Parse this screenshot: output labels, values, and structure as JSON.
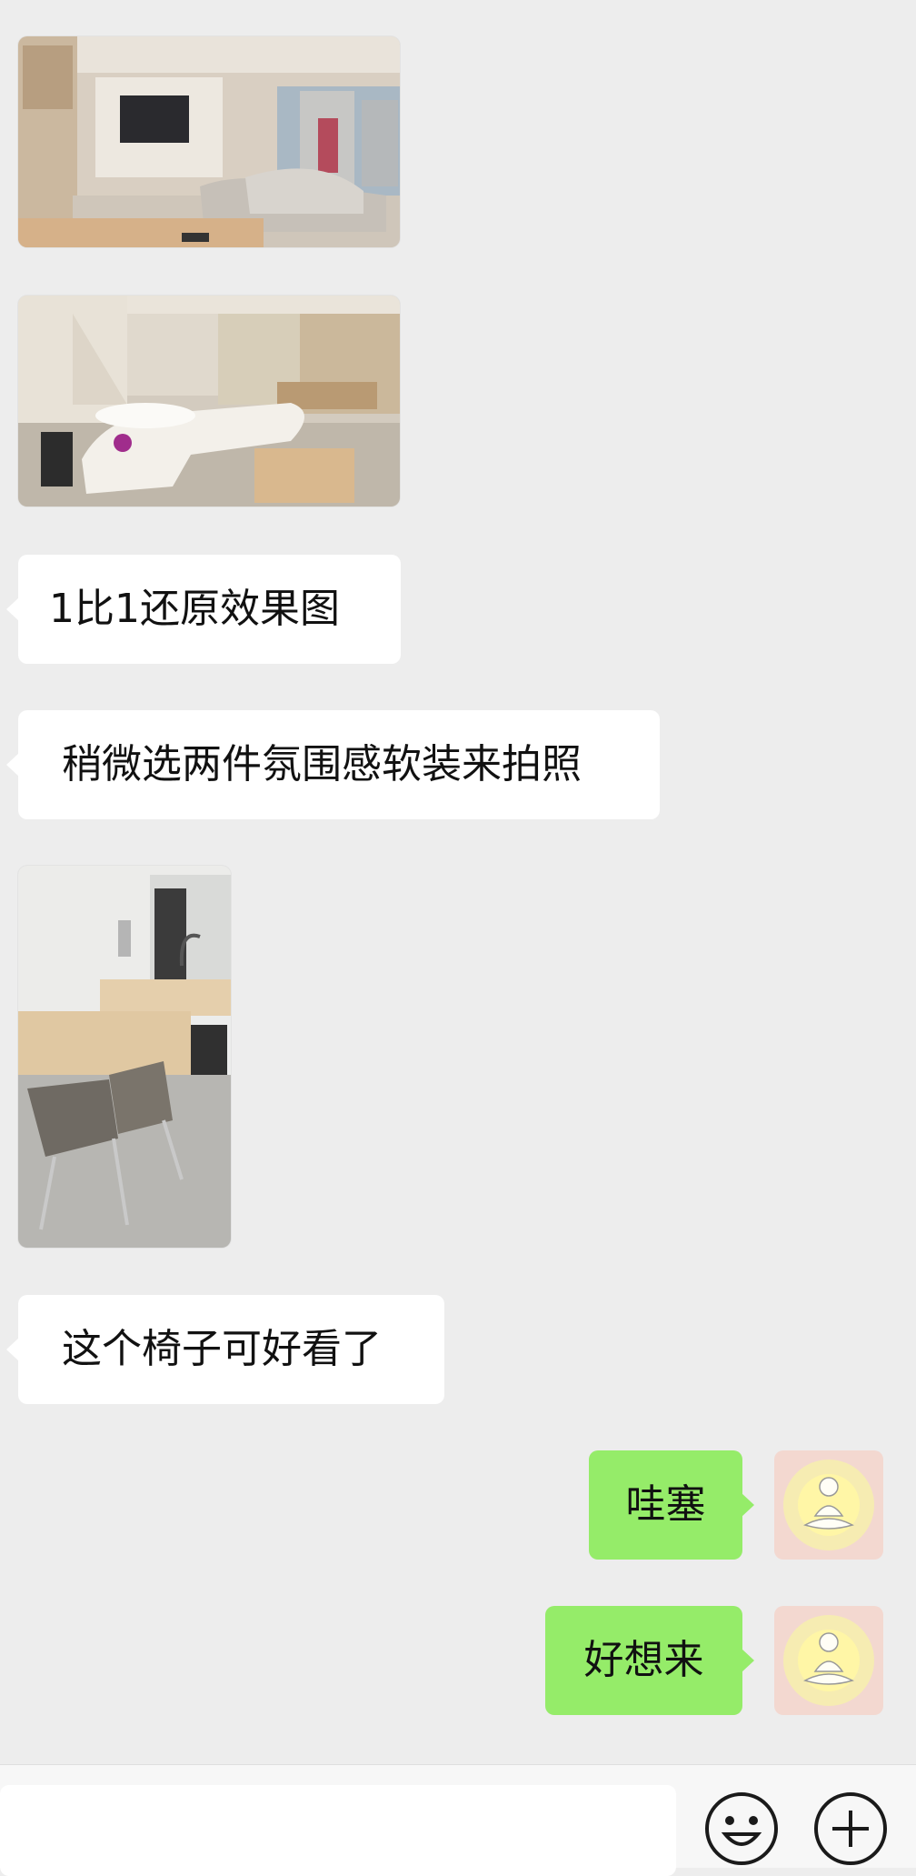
{
  "messages": [
    {
      "type": "image",
      "direction": "in",
      "description_name": "living-room-photo-1"
    },
    {
      "type": "image",
      "direction": "in",
      "description_name": "living-room-photo-2"
    },
    {
      "type": "text",
      "direction": "in",
      "text": "1比1还原效果图"
    },
    {
      "type": "text",
      "direction": "in",
      "text": "稍微选两件氛围感软装来拍照"
    },
    {
      "type": "image",
      "direction": "in",
      "description_name": "kitchen-photo"
    },
    {
      "type": "text",
      "direction": "in",
      "text": "这个椅子可好看了"
    },
    {
      "type": "text",
      "direction": "out",
      "text": "哇塞"
    },
    {
      "type": "text",
      "direction": "out",
      "text": "好想来"
    }
  ],
  "input_bar": {
    "text_value": "",
    "icons": [
      "emoji-icon",
      "plus-icon"
    ]
  },
  "colors": {
    "background": "#ededed",
    "incoming_bubble": "#ffffff",
    "outgoing_bubble": "#95ec69"
  }
}
